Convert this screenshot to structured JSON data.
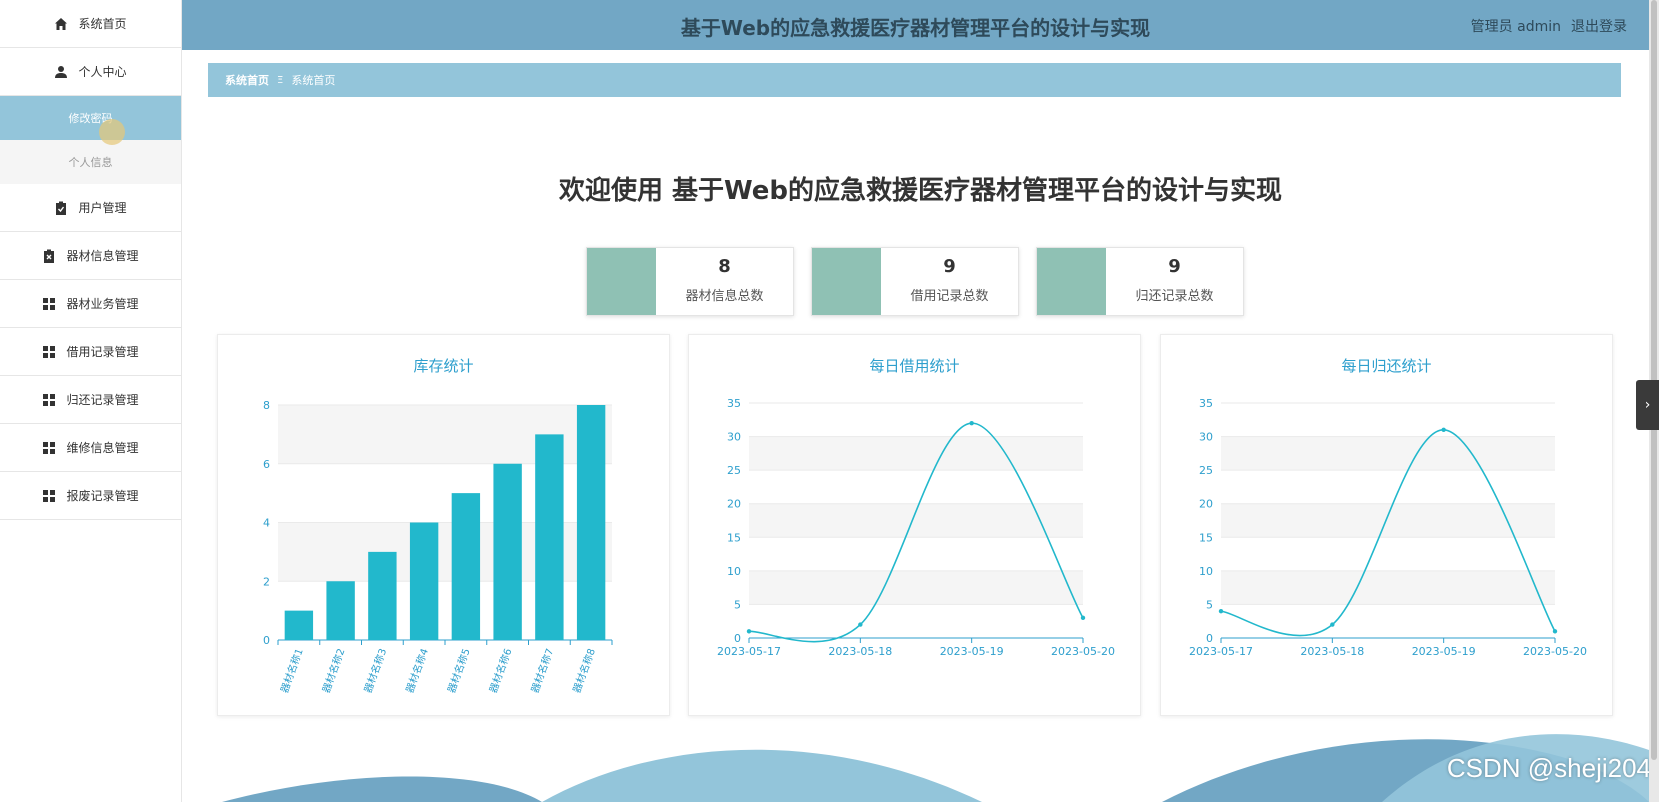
{
  "header": {
    "title": "基于Web的应急救援医疗器材管理平台的设计与实现",
    "user_label": "管理员 admin",
    "logout_label": "退出登录"
  },
  "sidebar": {
    "items": [
      {
        "label": "系统首页",
        "icon": "home-icon"
      },
      {
        "label": "个人中心",
        "icon": "user-icon"
      },
      {
        "label": "修改密码",
        "sub": true,
        "active": true
      },
      {
        "label": "个人信息",
        "sub": true
      },
      {
        "label": "用户管理",
        "icon": "clipboard-check-icon"
      },
      {
        "label": "器材信息管理",
        "icon": "clipboard-x-icon"
      },
      {
        "label": "器材业务管理",
        "icon": "grid-icon"
      },
      {
        "label": "借用记录管理",
        "icon": "grid-icon"
      },
      {
        "label": "归还记录管理",
        "icon": "grid-icon"
      },
      {
        "label": "维修信息管理",
        "icon": "grid-icon"
      },
      {
        "label": "报废记录管理",
        "icon": "grid-icon"
      }
    ]
  },
  "breadcrumb": {
    "home": "系统首页",
    "sep": "Ξ",
    "current": "系统首页"
  },
  "welcome": "欢迎使用 基于Web的应急救援医疗器材管理平台的设计与实现",
  "stats": [
    {
      "value": "8",
      "label": "器材信息总数"
    },
    {
      "value": "9",
      "label": "借用记录总数"
    },
    {
      "value": "9",
      "label": "归还记录总数"
    }
  ],
  "colors": {
    "header_bg": "#72a7c5",
    "breadcrumb_bg": "#93c5da",
    "stat_accent": "#8fc1b4",
    "chart_series": "#22b8cc",
    "chart_title": "#2e9fcd"
  },
  "chart_data": [
    {
      "type": "bar",
      "title": "库存统计",
      "categories": [
        "器材名称1",
        "器材名称2",
        "器材名称3",
        "器材名称4",
        "器材名称5",
        "器材名称6",
        "器材名称7",
        "器材名称8"
      ],
      "values": [
        1,
        2,
        3,
        4,
        5,
        6,
        7,
        8
      ],
      "ylim": [
        0,
        8
      ],
      "yticks": [
        0,
        2,
        4,
        6,
        8
      ]
    },
    {
      "type": "line",
      "title": "每日借用统计",
      "x": [
        "2023-05-17",
        "2023-05-18",
        "2023-05-19",
        "2023-05-20"
      ],
      "values": [
        1,
        2,
        32,
        3
      ],
      "ylim": [
        0,
        35
      ],
      "yticks": [
        0,
        5,
        10,
        15,
        20,
        25,
        30,
        35
      ]
    },
    {
      "type": "line",
      "title": "每日归还统计",
      "x": [
        "2023-05-17",
        "2023-05-18",
        "2023-05-19",
        "2023-05-20"
      ],
      "values": [
        4,
        2,
        31,
        1
      ],
      "ylim": [
        0,
        35
      ],
      "yticks": [
        0,
        5,
        10,
        15,
        20,
        25,
        30,
        35
      ]
    }
  ],
  "watermark": "CSDN @sheji204",
  "side_toggle_glyph": "›"
}
